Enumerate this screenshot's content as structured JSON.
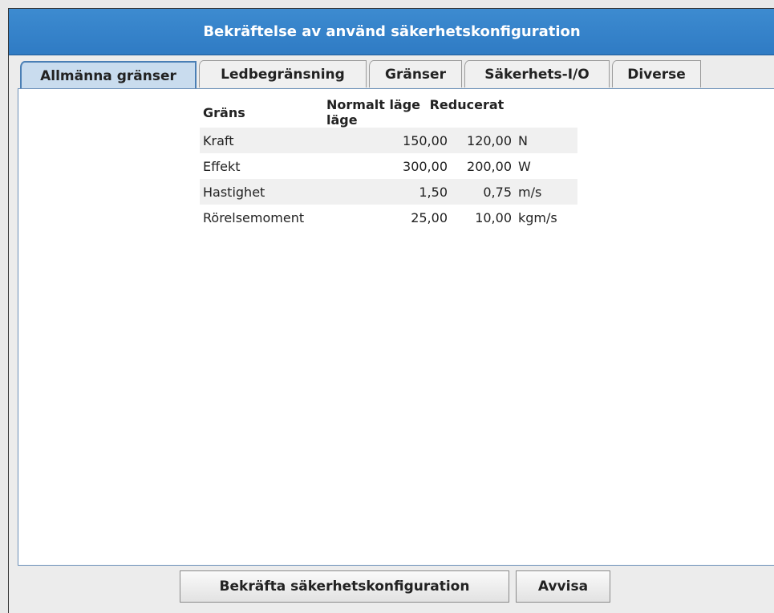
{
  "dialog": {
    "title": "Bekräftelse av använd säkerhetskonfiguration"
  },
  "tabs": [
    {
      "label": "Allmänna gränser",
      "active": true
    },
    {
      "label": "Ledbegränsning",
      "active": false
    },
    {
      "label": "Gränser",
      "active": false
    },
    {
      "label": "Säkerhets-I/O",
      "active": false
    },
    {
      "label": "Diverse",
      "active": false
    }
  ],
  "table": {
    "headers": [
      "Gräns",
      "Normalt läge",
      "Reducerat läge"
    ],
    "rows": [
      {
        "name": "Kraft",
        "normal": "150,00",
        "reduced": "120,00",
        "unit": "N"
      },
      {
        "name": "Effekt",
        "normal": "300,00",
        "reduced": "200,00",
        "unit": "W"
      },
      {
        "name": "Hastighet",
        "normal": "1,50",
        "reduced": "0,75",
        "unit": "m/s"
      },
      {
        "name": "Rörelsemoment",
        "normal": "25,00",
        "reduced": "10,00",
        "unit": "kgm/s"
      }
    ]
  },
  "buttons": {
    "confirm": "Bekräfta säkerhetskonfiguration",
    "reject": "Avvisa"
  }
}
